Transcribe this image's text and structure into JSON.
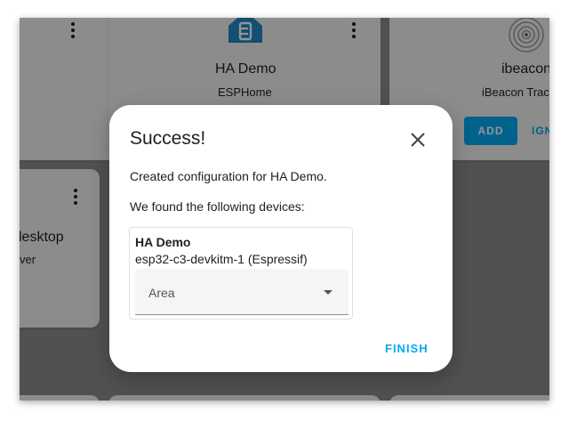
{
  "background_cards": {
    "ha_demo": {
      "title": "HA Demo",
      "subtitle": "ESPHome",
      "icon": "esphome-icon"
    },
    "ibeacon": {
      "title": "ibeacon",
      "subtitle": "iBeacon Trac",
      "icon": "ibeacon-icon",
      "add_label": "ADD",
      "ignore_label": "IGN"
    },
    "desktop": {
      "title": "lesktop",
      "subtitle": "ver"
    }
  },
  "dialog": {
    "title": "Success!",
    "created_text": "Created configuration for HA Demo.",
    "found_text": "We found the following devices:",
    "device": {
      "name": "HA Demo",
      "model": "esp32-c3-devkitm-1 (Espressif)",
      "area_label": "Area"
    },
    "finish_label": "FINISH"
  },
  "colors": {
    "accent": "#03a9f4",
    "esphome_blue": "#1e88c7"
  }
}
